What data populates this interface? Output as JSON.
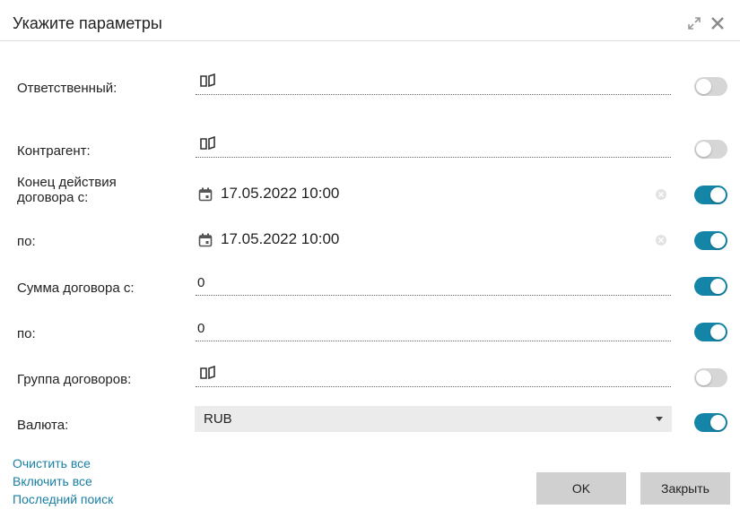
{
  "dialog": {
    "title": "Укажите параметры"
  },
  "fields": {
    "responsible": {
      "label": "Ответственный:",
      "value": "",
      "enabled": false
    },
    "counterparty": {
      "label": "Контрагент:",
      "value": "",
      "enabled": false
    },
    "end_from": {
      "label": "Конец действия договора с:",
      "value": "17.05.2022 10:00",
      "enabled": true
    },
    "end_to": {
      "label": "по:",
      "value": "17.05.2022 10:00",
      "enabled": true
    },
    "sum_from": {
      "label": "Сумма договора с:",
      "value": "0",
      "enabled": true
    },
    "sum_to": {
      "label": "по:",
      "value": "0",
      "enabled": true
    },
    "group": {
      "label": "Группа договоров:",
      "value": "",
      "enabled": false
    },
    "currency": {
      "label": "Валюта:",
      "value": "RUB",
      "enabled": true
    }
  },
  "links": {
    "clear_all": "Очистить все",
    "enable_all": "Включить все",
    "last_search": "Последний поиск"
  },
  "buttons": {
    "ok": "OK",
    "close": "Закрыть"
  },
  "colors": {
    "accent": "#1485a6",
    "link": "#1a7fa3",
    "toggle_off": "#d6d6d6",
    "button_bg": "#d0d0d0"
  }
}
